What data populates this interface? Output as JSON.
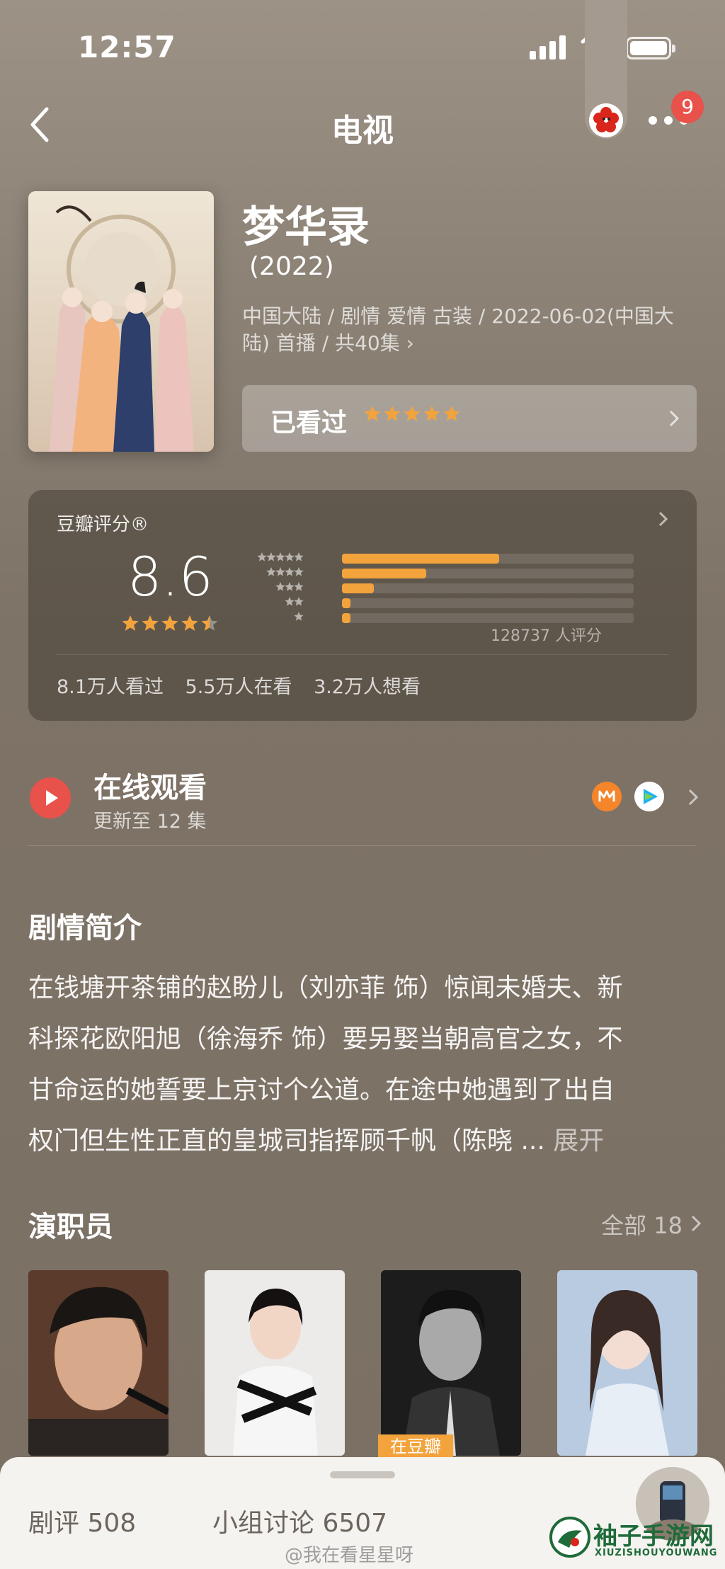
{
  "status": {
    "time": "12:57"
  },
  "nav": {
    "title": "电视",
    "badge_count": "9"
  },
  "show": {
    "title": "梦华录",
    "year": "(2022)",
    "meta": "中国大陆 / 剧情 爱情 古装 / 2022-06-02(中国大陆) 首播 / 共40集 ›",
    "seen_label": "已看过",
    "my_rating": 5
  },
  "rating": {
    "label": "豆瓣评分®",
    "score": "8.6",
    "score_stars": 4.5,
    "count_text": "128737 人评分",
    "distribution": [
      {
        "stars": 5,
        "fraction": 0.54
      },
      {
        "stars": 4,
        "fraction": 0.29
      },
      {
        "stars": 3,
        "fraction": 0.11
      },
      {
        "stars": 2,
        "fraction": 0.03
      },
      {
        "stars": 1,
        "fraction": 0.03
      }
    ],
    "stats": [
      "8.1万人看过",
      "5.5万人在看",
      "3.2万人想看"
    ]
  },
  "online": {
    "title": "在线观看",
    "subtitle": "更新至 12 集",
    "icons": [
      "mango-tv-icon",
      "tencent-video-icon"
    ]
  },
  "synopsis": {
    "title": "剧情简介",
    "lines": [
      "在钱塘开茶铺的赵盼儿（刘亦菲 饰）惊闻未婚夫、新",
      "科探花欧阳旭（徐海乔 饰）要另娶当朝高官之女，不",
      "甘命运的她誓要上京讨个公道。在途中她遇到了出自",
      "权门但生性正直的皇城司指挥顾千帆（陈晓 ... "
    ],
    "expand_label": "展开"
  },
  "cast": {
    "title": "演职员",
    "all_label": "全部 18",
    "tag_label": "在豆瓣"
  },
  "bottom": {
    "tab_review": "剧评 508",
    "tab_group": "小组讨论 6507",
    "watermark": "@我在看星星呀",
    "logo_text": "袖子手游网",
    "logo_sub": "XIUZISHOUYOUWANG"
  },
  "colors": {
    "accent": "#f3a33c",
    "red": "#e9514b",
    "bg": "#7b7064"
  }
}
